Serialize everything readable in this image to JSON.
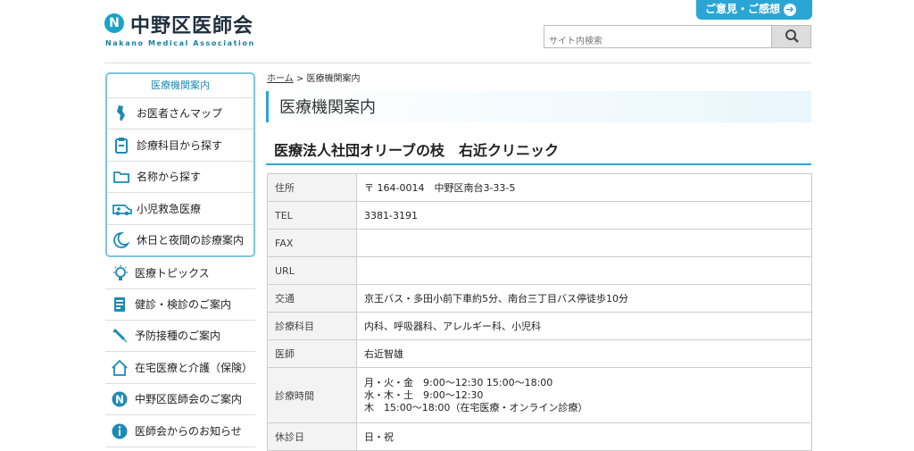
{
  "header": {
    "logo_mark": "N",
    "logo_jp": "中野区医師会",
    "logo_en": "Nakano Medical Association",
    "opinion_label": "ご意見・ご感想",
    "search_placeholder": "サイト内検索"
  },
  "sidebar": {
    "title": "医療機関案内",
    "box_items": [
      {
        "label": "お医者さんマップ",
        "icon": "map-icon"
      },
      {
        "label": "診療科目から探す",
        "icon": "clipboard-icon"
      },
      {
        "label": "名称から探す",
        "icon": "folder-icon"
      },
      {
        "label": "小児救急医療",
        "icon": "ambulance-icon"
      },
      {
        "label": "休日と夜間の診療案内",
        "icon": "moon-icon"
      }
    ],
    "items": [
      {
        "label": "医療トピックス",
        "icon": "lightbulb-icon"
      },
      {
        "label": "健診・検診のご案内",
        "icon": "checklist-icon"
      },
      {
        "label": "予防接種のご案内",
        "icon": "syringe-icon"
      },
      {
        "label": "在宅医療と介護（保険）",
        "icon": "home-icon"
      },
      {
        "label": "中野区医師会のご案内",
        "icon": "logo-icon"
      },
      {
        "label": "医師会からのお知らせ",
        "icon": "info-icon"
      }
    ]
  },
  "breadcrumb": {
    "home": "ホーム",
    "sep": ">",
    "current": "医療機関案内"
  },
  "page_title": "医療機関案内",
  "clinic_name": "医療法人社団オリーブの枝　右近クリニック",
  "info_rows": [
    {
      "label": "住所",
      "value": "〒 164-0014　中野区南台3-33-5"
    },
    {
      "label": "TEL",
      "value": "3381-3191"
    },
    {
      "label": "FAX",
      "value": ""
    },
    {
      "label": "URL",
      "value": ""
    },
    {
      "label": "交通",
      "value": "京王バス・多田小前下車約5分、南台三丁目バス停徒歩10分"
    },
    {
      "label": "診療科目",
      "value": "内科、呼吸器科、アレルギー科、小児科"
    },
    {
      "label": "医師",
      "value": "右近智雄"
    }
  ],
  "hours": {
    "label": "診療時間",
    "lines": [
      "月・火・金　9:00～12:30 15:00～18:00",
      "水・木・土　9:00～12:30",
      "木　15:00～18:00（在宅医療・オンライン診療）"
    ]
  },
  "closed": {
    "label": "休診日",
    "value": "日・祝"
  }
}
